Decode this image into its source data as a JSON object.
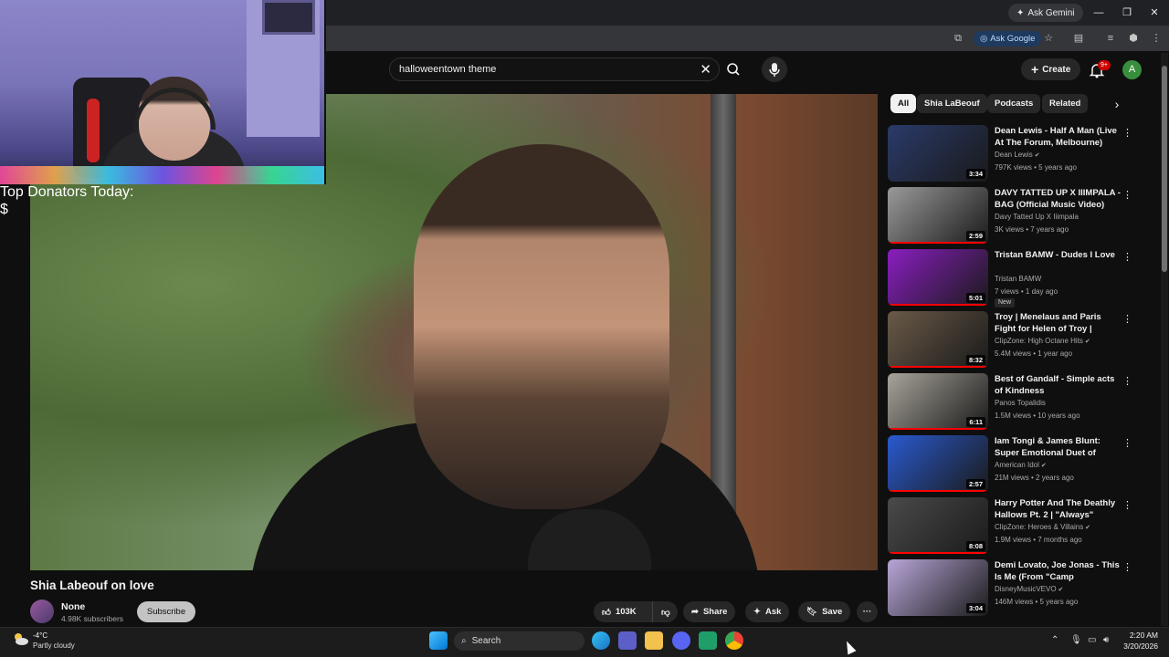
{
  "browser": {
    "ask_gemini": "Ask Gemini",
    "ask_google": "Ask Google"
  },
  "header": {
    "search_query": "halloweentown theme",
    "create_label": "Create",
    "notifications_badge": "9+",
    "account_initial": "A"
  },
  "overlay": {
    "donators_label": "Top Donators Today:",
    "donators_value": "$"
  },
  "video": {
    "title": "Shia Labeouf on love",
    "channel_name": "None",
    "channel_subscribers": "4.98K subscribers",
    "subscribe_label": "Subscribe",
    "likes": "103K",
    "share_label": "Share",
    "ask_label": "Ask",
    "save_label": "Save"
  },
  "chips": [
    "All",
    "Shia LaBeouf",
    "Podcasts",
    "Related"
  ],
  "recommendations": [
    {
      "title": "Dean Lewis - Half A Man (Live At The Forum, Melbourne)",
      "channel": "Dean Lewis",
      "verified": true,
      "meta": "797K views • 5 years ago",
      "duration": "3:34",
      "new": "",
      "thumb_color": "#2a3a6a"
    },
    {
      "title": "DAVY TATTED UP X IIIMPALA - BAG (Official Music Video)",
      "channel": "Davy Tatted Up X Iiimpala",
      "verified": false,
      "meta": "3K views • 7 years ago",
      "duration": "2:59",
      "new": "",
      "thumb_color": "#9a9a9a"
    },
    {
      "title": "Tristan BAMW - Dudes I Love",
      "channel": "Tristan BAMW",
      "verified": false,
      "meta": "7 views • 1 day ago",
      "duration": "5:01",
      "new": "New",
      "thumb_color": "#8a1ec0"
    },
    {
      "title": "Troy | Menelaus and Paris Fight for Helen of Troy | ClipZone: ...",
      "channel": "ClipZone: High Octane Hits",
      "verified": true,
      "meta": "5.4M views • 1 year ago",
      "duration": "8:32",
      "new": "",
      "thumb_color": "#6a5a48"
    },
    {
      "title": "Best of Gandalf - Simple acts of Kindness",
      "channel": "Panos Topalidis",
      "verified": false,
      "meta": "1.5M views • 10 years ago",
      "duration": "6:11",
      "new": "",
      "thumb_color": "#a8a49a"
    },
    {
      "title": "Iam Tongi & James Blunt: Super Emotional Duet of \"Monsters\" ...",
      "channel": "American Idol",
      "verified": true,
      "meta": "21M views • 2 years ago",
      "duration": "2:57",
      "new": "",
      "thumb_color": "#2a5ad0"
    },
    {
      "title": "Harry Potter And The Deathly Hallows Pt. 2 | \"Always\" Snape'...",
      "channel": "ClipZone: Heroes & Villains",
      "verified": true,
      "meta": "1.9M views • 7 months ago",
      "duration": "8:08",
      "new": "",
      "thumb_color": "#4a4a4a"
    },
    {
      "title": "Demi Lovato, Joe Jonas - This Is Me (From \"Camp Rock\"/Sin...",
      "channel": "DisneyMusicVEVO",
      "verified": true,
      "meta": "146M views • 5 years ago",
      "duration": "3:04",
      "new": "",
      "thumb_color": "#b8a6d8"
    }
  ],
  "taskbar": {
    "temperature": "-4°C",
    "weather": "Partly cloudy",
    "search_label": "Search",
    "time": "2:20 AM",
    "date": "3/20/2026"
  }
}
